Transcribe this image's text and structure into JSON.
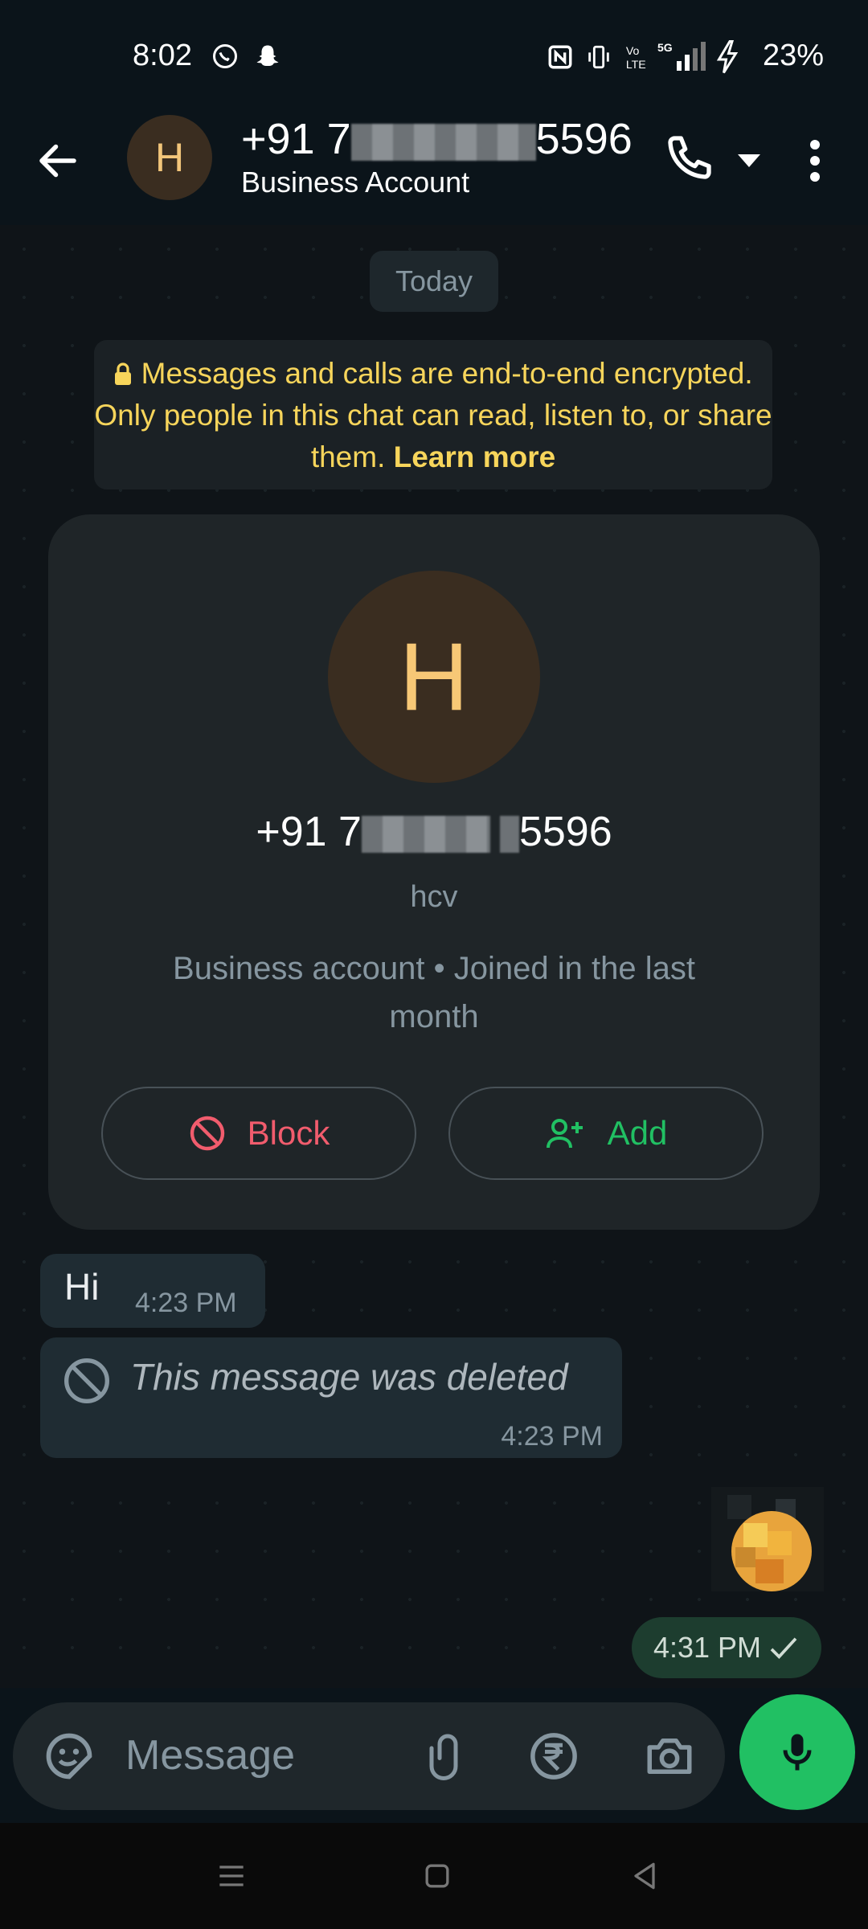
{
  "status_bar": {
    "time": "8:02",
    "battery": "23%",
    "icons": [
      "whatsapp-icon",
      "snapchat-icon",
      "nfc-icon",
      "vibrate-icon",
      "volte-icon",
      "5g-icon",
      "signal-icon",
      "charging-icon"
    ]
  },
  "header": {
    "avatar_letter": "H",
    "title_prefix": "+91 7",
    "title_suffix": "5596",
    "subtitle": "Business Account"
  },
  "chat": {
    "day_label": "Today",
    "encryption_text": "Messages and calls are end-to-end encrypted. Only people in this chat can read, listen to, or share them.",
    "learn_more": "Learn more",
    "profile_card": {
      "avatar_letter": "H",
      "number_prefix": "+91 7",
      "number_suffix": "5596",
      "name": "hcv",
      "description": "Business account • Joined in the last month",
      "block_label": "Block",
      "add_label": "Add"
    },
    "messages": [
      {
        "text": "Hi",
        "time": "4:23 PM"
      },
      {
        "text": "This message was deleted",
        "time": "4:23 PM"
      }
    ],
    "outgoing_time": "4:31 PM"
  },
  "composer": {
    "placeholder": "Message"
  },
  "colors": {
    "accent_green": "#21c063",
    "block_red": "#f15c6d",
    "encryption_yellow": "#f7d55b"
  }
}
